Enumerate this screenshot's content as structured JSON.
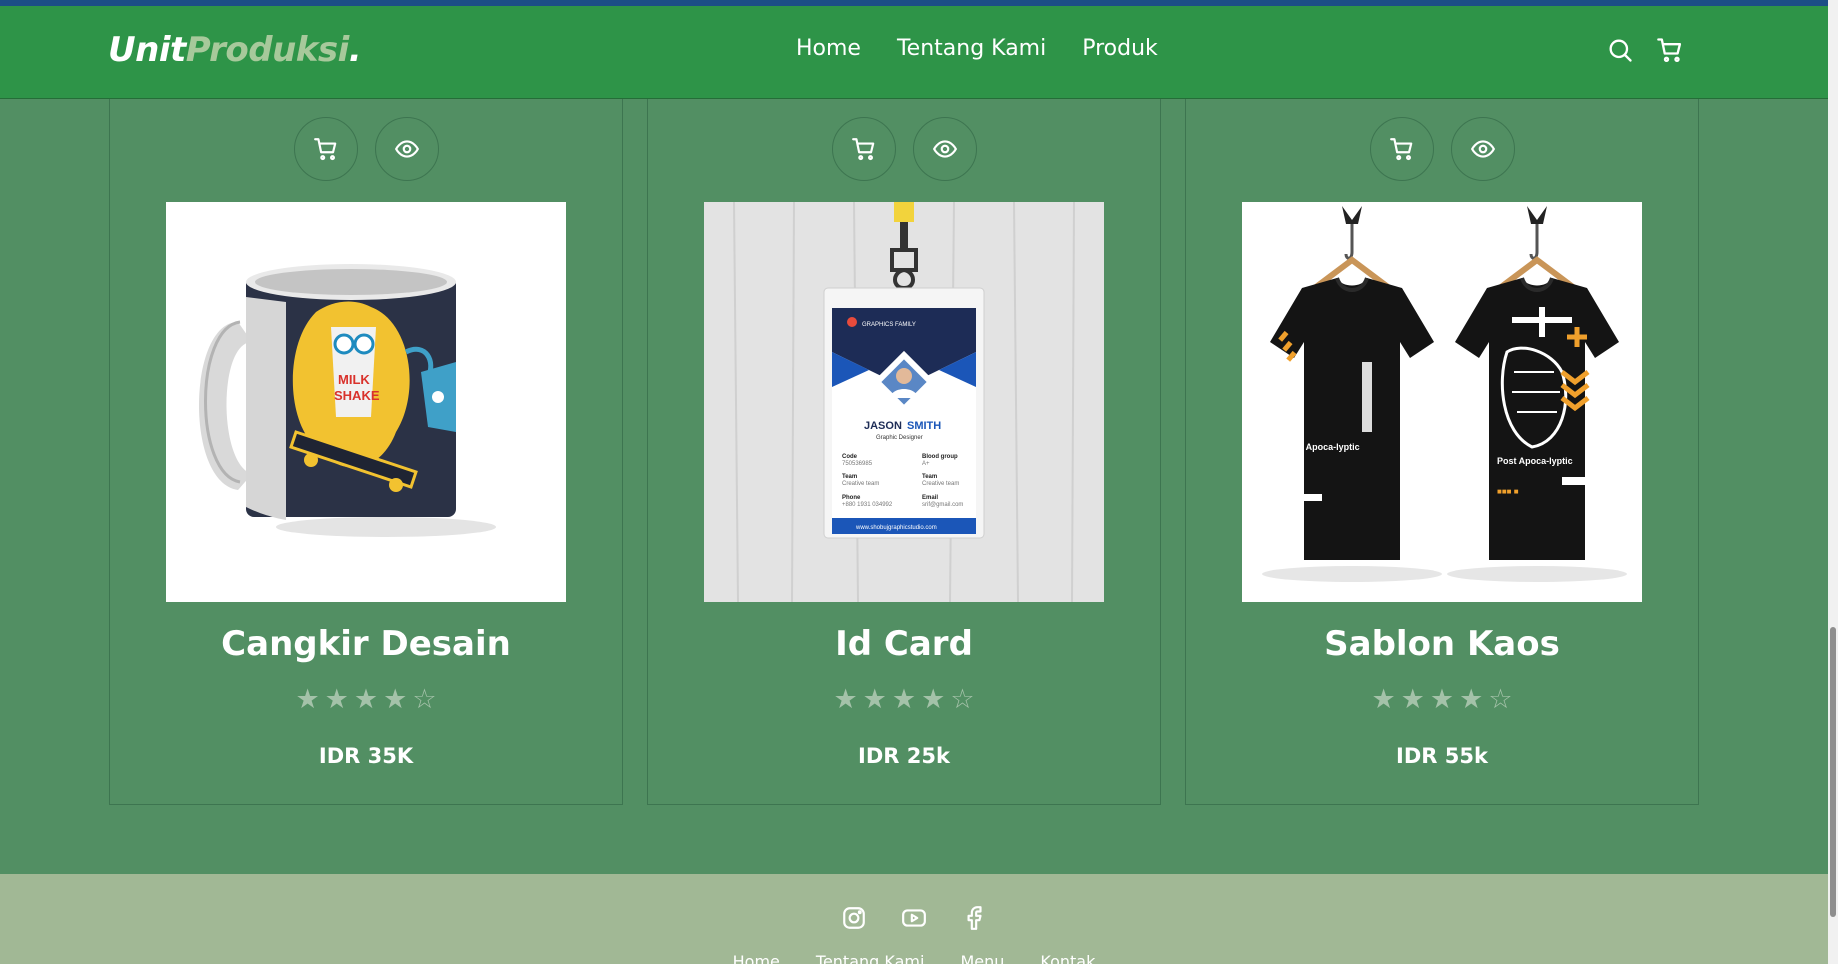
{
  "brand": {
    "part1": "Unit",
    "part2": "Produksi",
    "dot": "."
  },
  "nav": {
    "items": [
      "Home",
      "Tentang Kami",
      "Produk"
    ]
  },
  "header_icons": [
    "search-icon",
    "cart-icon"
  ],
  "products": [
    {
      "name": "Cangkir Desain",
      "price": "IDR 35K",
      "rating": 4,
      "max_rating": 5,
      "image": "mug-image"
    },
    {
      "name": "Id Card",
      "price": "IDR 25k",
      "rating": 4,
      "max_rating": 5,
      "image": "id-card-image"
    },
    {
      "name": "Sablon Kaos",
      "price": "IDR 55k",
      "rating": 4,
      "max_rating": 5,
      "image": "tshirt-image"
    }
  ],
  "id_card": {
    "company": "GRAPHICS FAMILY",
    "first": "JASON",
    "last": "SMITH",
    "role": "Graphic Designer",
    "fields": [
      {
        "label": "Code",
        "value": "750536985"
      },
      {
        "label": "Blood group",
        "value": "A+"
      },
      {
        "label": "Team",
        "value": "Creative team"
      },
      {
        "label": "Team",
        "value": "Creative team"
      },
      {
        "label": "Phone",
        "value": "+880 1931 034992"
      },
      {
        "label": "Email",
        "value": "srif@gmail.com"
      }
    ],
    "website": "www.shobujgraphicstudio.com"
  },
  "mug": {
    "text_top": "MILK",
    "text_bottom": "SHAKE"
  },
  "tshirt": {
    "front": "Post Apoca-lyptic",
    "back": "Post Apoca-lyptic"
  },
  "footer": {
    "social_icons": [
      "instagram-icon",
      "youtube-icon",
      "facebook-icon"
    ],
    "links": [
      "Home",
      "Tentang Kami",
      "Menu",
      "Kontak"
    ]
  },
  "colors": {
    "primary": "#2e9448",
    "background": "#528f63",
    "footer": "#a1b895",
    "accent": "#1c4e86"
  }
}
